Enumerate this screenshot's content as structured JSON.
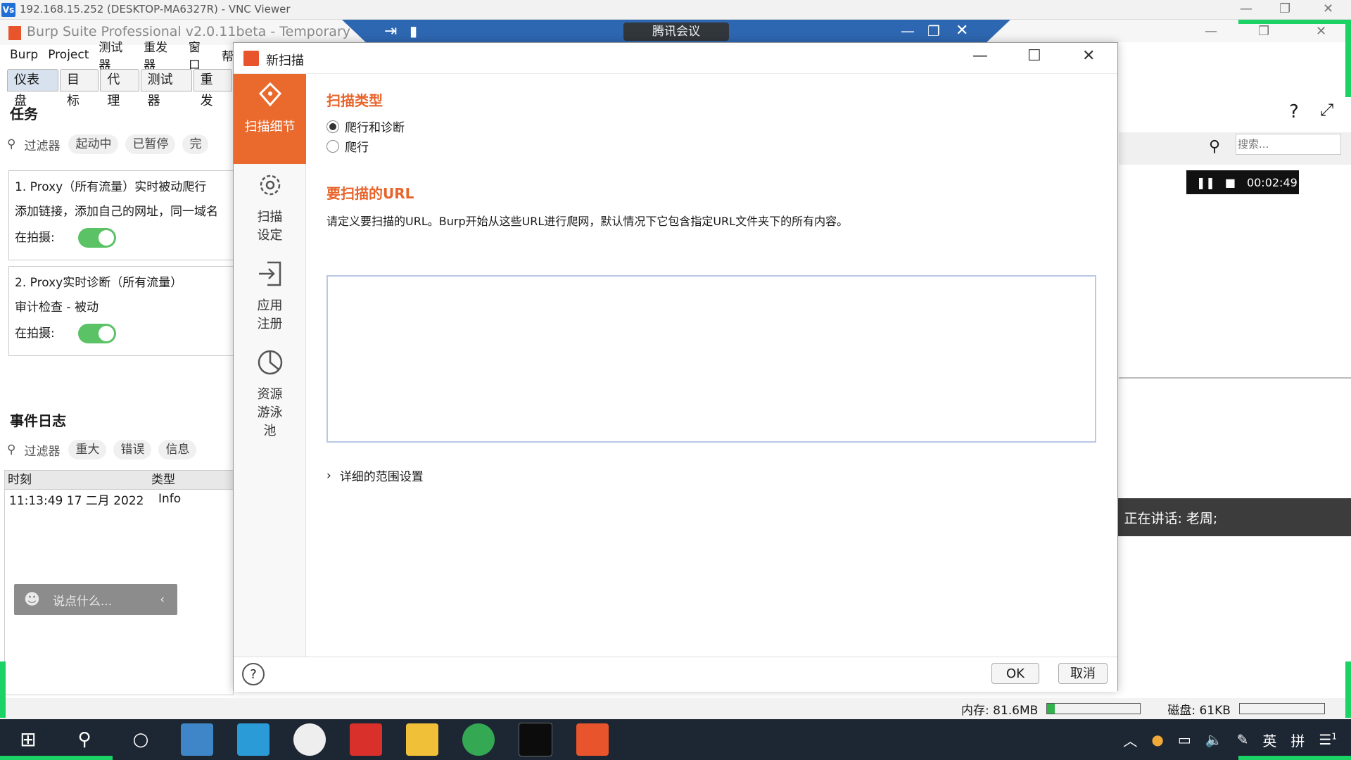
{
  "vnc": {
    "title": "192.168.15.252 (DESKTOP-MA6327R) - VNC Viewer",
    "icon": "Vs"
  },
  "burp": {
    "title": "Burp Suite Professional v2.0.11beta - Temporary",
    "menu": [
      "Burp",
      "Project",
      "测试器",
      "重发器",
      "窗口",
      "帮"
    ],
    "tabs": [
      "仪表盘",
      "目标",
      "代理",
      "测试器",
      "重发"
    ]
  },
  "remote": {
    "meeting": "腾讯会议"
  },
  "tasks": {
    "title": "任务",
    "filter_label": "过滤器",
    "chips": [
      "起动中",
      "已暂停",
      "完"
    ],
    "items": [
      {
        "name": "1. Proxy（所有流量）实时被动爬行",
        "desc": "添加链接，添加自己的网址，同一域名",
        "capturing_label": "在拍摄:"
      },
      {
        "name": "2. Proxy实时诊断（所有流量）",
        "desc": "审计检查 - 被动",
        "capturing_label": "在拍摄:"
      }
    ]
  },
  "event_log": {
    "title": "事件日志",
    "filter_label": "过滤器",
    "chips": [
      "重大",
      "错误",
      "信息"
    ],
    "columns": [
      "时刻",
      "类型"
    ],
    "rows": [
      {
        "time": "11:13:49 17 二月 2022",
        "type": "Info"
      }
    ],
    "chat_placeholder": "说点什么..."
  },
  "dialog": {
    "title": "新扫描",
    "sidebar": [
      {
        "label": "扫描细节",
        "icon": "scan-detail-icon"
      },
      {
        "label": "扫描设定",
        "icon": "gear-icon"
      },
      {
        "label": "应用注册",
        "icon": "login-icon"
      },
      {
        "label": "资源游泳池",
        "icon": "pie-icon"
      }
    ],
    "scan_type_heading": "扫描类型",
    "radio_crawl_audit": "爬行和诊断",
    "radio_crawl": "爬行",
    "url_heading": "要扫描的URL",
    "url_desc": "请定义要扫描的URL。Burp开始从这些URL进行爬网，默认情况下它包含指定URL文件夹下的所有内容。",
    "url_value": "",
    "scope_label": "详细的范围设置",
    "ok": "OK",
    "cancel": "取消"
  },
  "right": {
    "search_placeholder": "搜索...",
    "recording_time": "00:02:49",
    "talking": "正在讲话: 老周;"
  },
  "status": {
    "memory": "内存: 81.6MB",
    "memory_fraction": 0.08,
    "disk": "磁盘: 61KB"
  },
  "tray": {
    "ime1": "英",
    "ime2": "拼",
    "notif": "1"
  }
}
